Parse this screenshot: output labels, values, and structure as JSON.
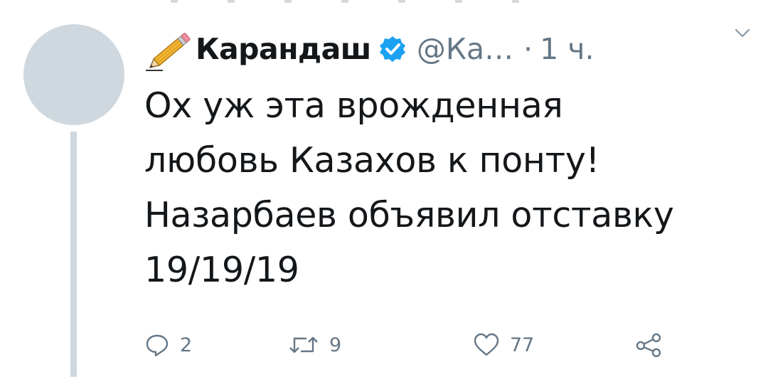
{
  "tweet": {
    "author": {
      "display_name": "Карандаш",
      "handle": "@Ка…",
      "verified": true,
      "name_emoji_icon": "pencil-icon"
    },
    "separator": "·",
    "time": "1 ч.",
    "menu_icon": "chevron-down-icon",
    "text": "Ох уж эта врожденная\nлюбовь Казахов к понту!\nНазарбаев объявил отставку\n19/19/19",
    "actions": {
      "reply": {
        "icon": "reply-icon",
        "count": "2"
      },
      "retweet": {
        "icon": "retweet-icon",
        "count": "9"
      },
      "like": {
        "icon": "heart-icon",
        "count": "77"
      },
      "share": {
        "icon": "share-icon"
      }
    }
  },
  "colors": {
    "text": "#14171a",
    "secondary": "#657786",
    "verified": "#1da1f2",
    "avatar_placeholder": "#cfd8de"
  }
}
